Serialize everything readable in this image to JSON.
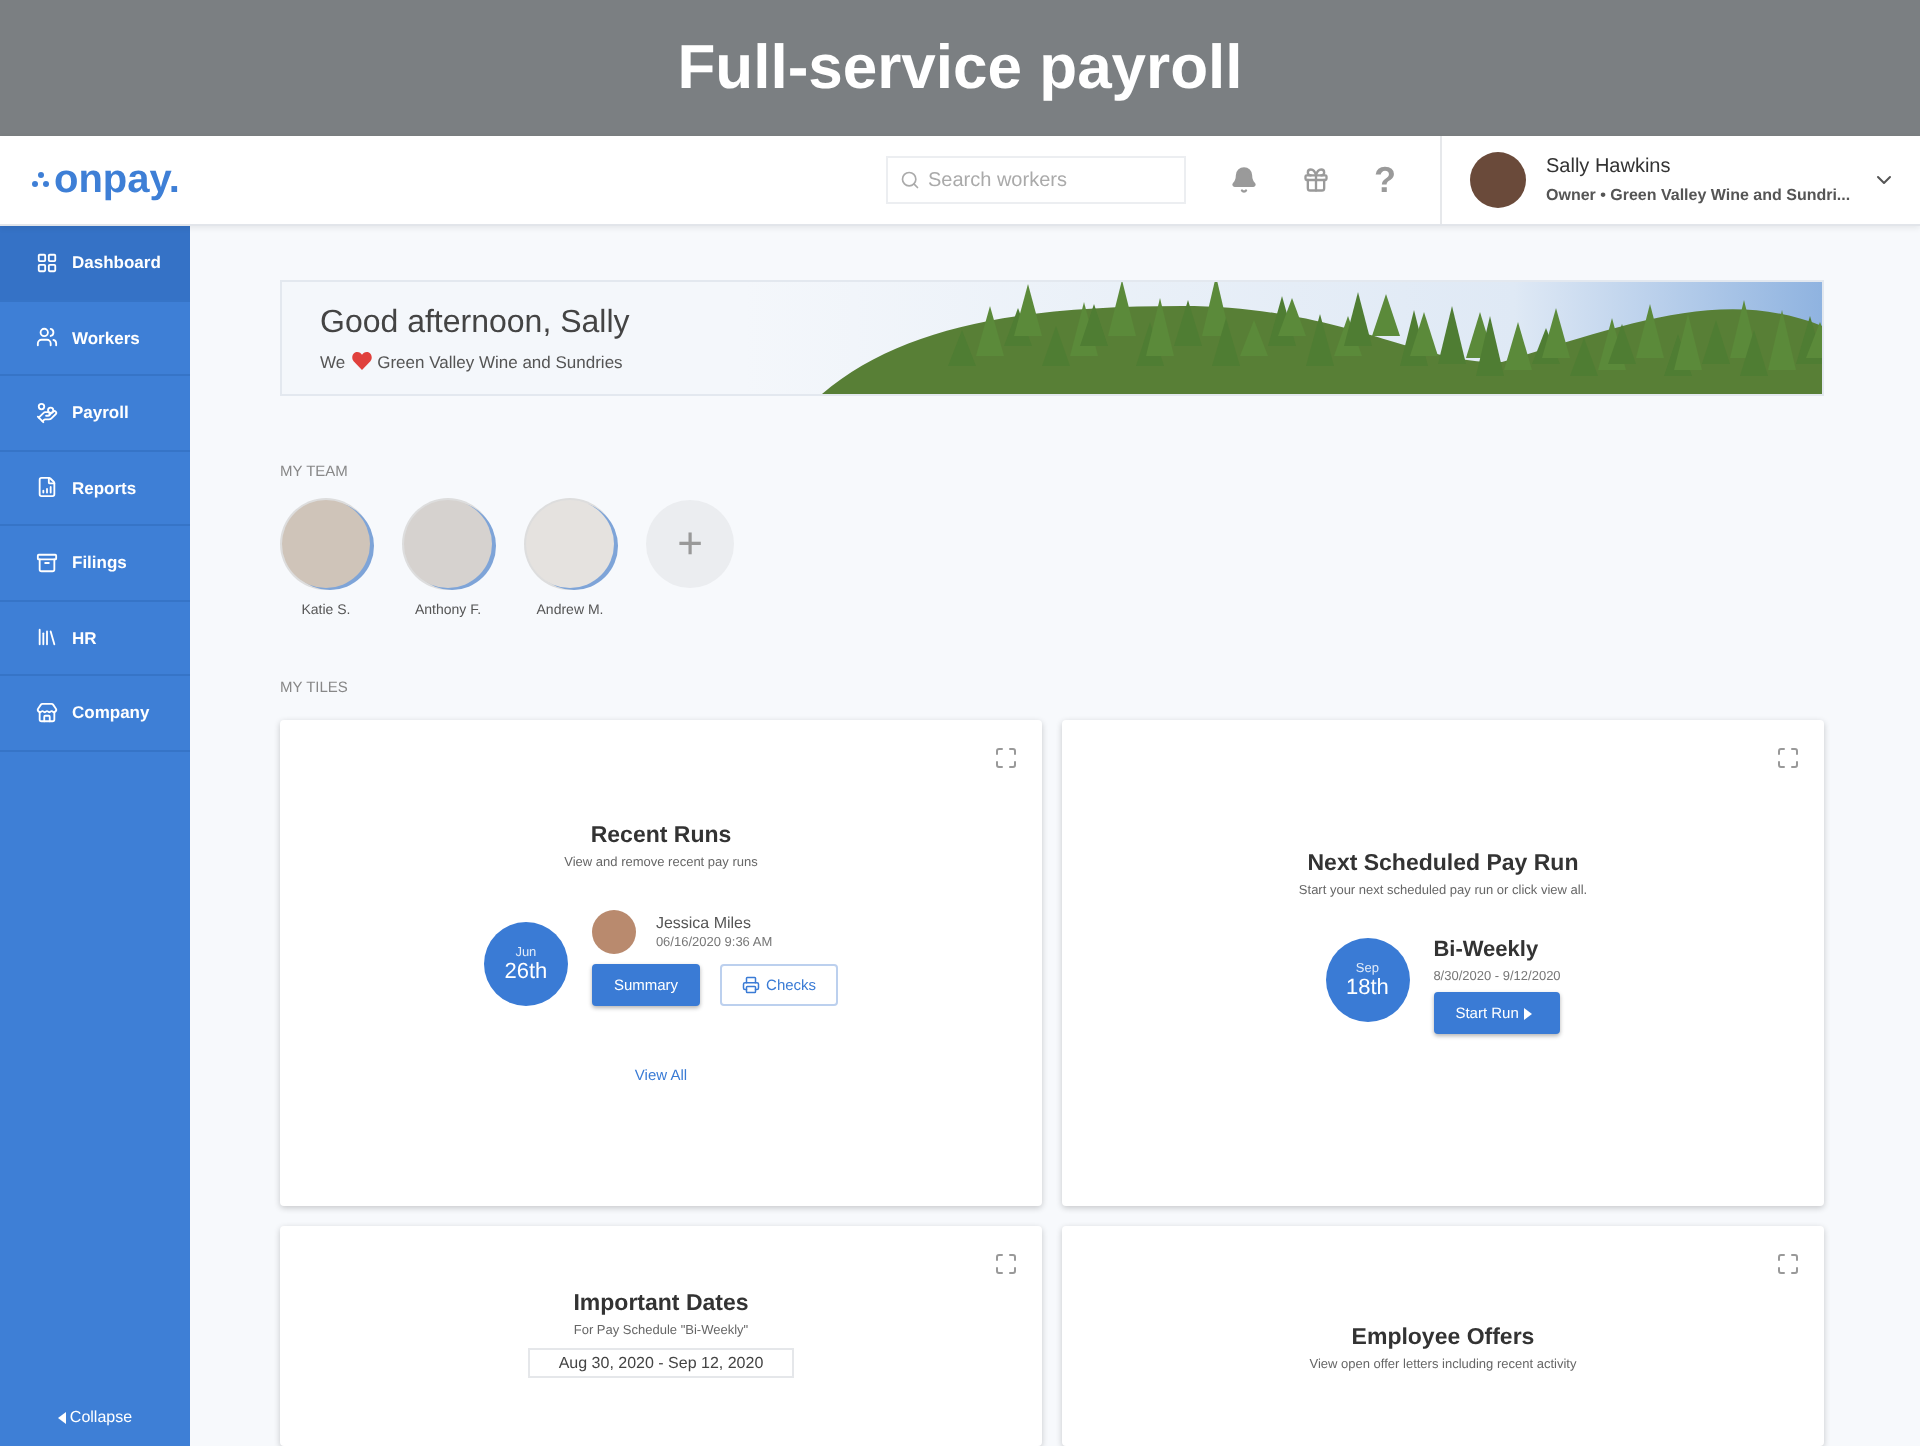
{
  "banner": {
    "title": "Full-service payroll"
  },
  "header": {
    "logo": "onpay.",
    "search": {
      "placeholder": "Search workers"
    },
    "help": "?",
    "user": {
      "name": "Sally Hawkins",
      "role": "Owner • Green Valley Wine and Sundri..."
    }
  },
  "sidebar": {
    "items": [
      {
        "label": "Dashboard",
        "selected": true
      },
      {
        "label": "Workers",
        "selected": false
      },
      {
        "label": "Payroll",
        "selected": false
      },
      {
        "label": "Reports",
        "selected": false
      },
      {
        "label": "Filings",
        "selected": false
      },
      {
        "label": "HR",
        "selected": false
      },
      {
        "label": "Company",
        "selected": false
      }
    ],
    "collapse": "Collapse"
  },
  "greeting": {
    "title": "Good afternoon, Sally",
    "before": "We",
    "company": "Green Valley Wine and Sundries"
  },
  "team": {
    "heading": "MY TEAM",
    "members": [
      "Katie S.",
      "Anthony F.",
      "Andrew M."
    ],
    "add": "+"
  },
  "tiles_heading": "MY TILES",
  "tiles": [
    {
      "kind": "recent",
      "title": "Recent Runs",
      "subtitle": "View and remove recent pay runs",
      "month": "Jun",
      "day": "26th",
      "person": "Jessica Miles",
      "time": "06/16/2020 9:36 AM",
      "primary": "Summary",
      "secondary": "Checks",
      "link": "View All"
    },
    {
      "kind": "next",
      "title": "Next Scheduled Pay Run",
      "subtitle": "Start your next scheduled pay run or click view all.",
      "month": "Sep",
      "day": "18th",
      "schedule": "Bi-Weekly",
      "range": "8/30/2020 - 9/12/2020",
      "primary": "Start Run"
    },
    {
      "kind": "dates",
      "title": "Important Dates",
      "subtitle": "For Pay Schedule \"Bi-Weekly\"",
      "range": "Aug 30, 2020 - Sep 12, 2020"
    },
    {
      "kind": "offers",
      "title": "Employee Offers",
      "subtitle": "View open offer letters including recent activity"
    }
  ]
}
